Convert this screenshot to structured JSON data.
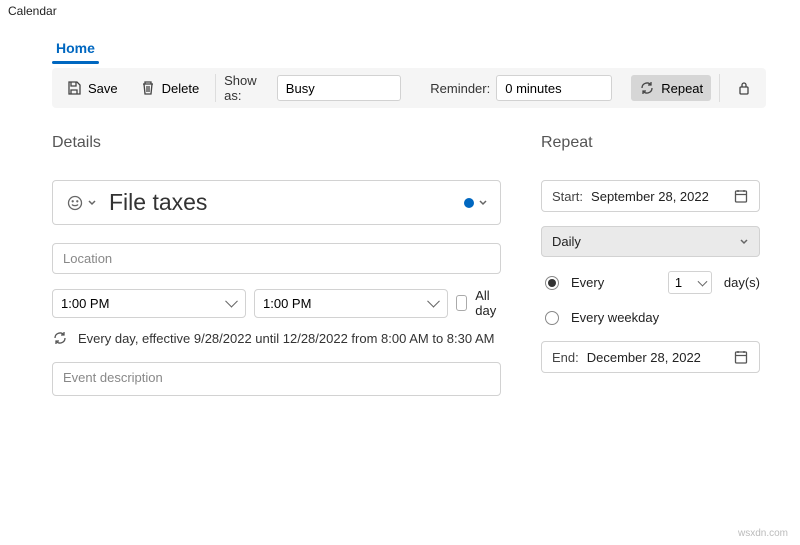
{
  "window": {
    "title": "Calendar"
  },
  "tabs": {
    "home": "Home"
  },
  "toolbar": {
    "save": "Save",
    "delete": "Delete",
    "show_as_label": "Show as:",
    "show_as_value": "Busy",
    "reminder_label": "Reminder:",
    "reminder_value": "0 minutes",
    "repeat": "Repeat"
  },
  "details": {
    "heading": "Details",
    "event_title": "File taxes",
    "location_placeholder": "Location",
    "location_value": "",
    "start_time": "1:00 PM",
    "end_time": "1:00 PM",
    "all_day_label": "All day",
    "all_day_checked": false,
    "recurrence_text": "Every day, effective 9/28/2022 until 12/28/2022 from 8:00 AM to 8:30 AM",
    "description_placeholder": "Event description",
    "description_value": "",
    "calendar_color": "#0067c0"
  },
  "repeat": {
    "heading": "Repeat",
    "start_label": "Start:",
    "start_value": "September 28, 2022",
    "frequency": "Daily",
    "every_label": "Every",
    "every_value": "1",
    "every_unit": "day(s)",
    "weekday_label": "Every weekday",
    "end_label": "End:",
    "end_value": "December 28, 2022"
  },
  "watermark": "wsxdn.com"
}
